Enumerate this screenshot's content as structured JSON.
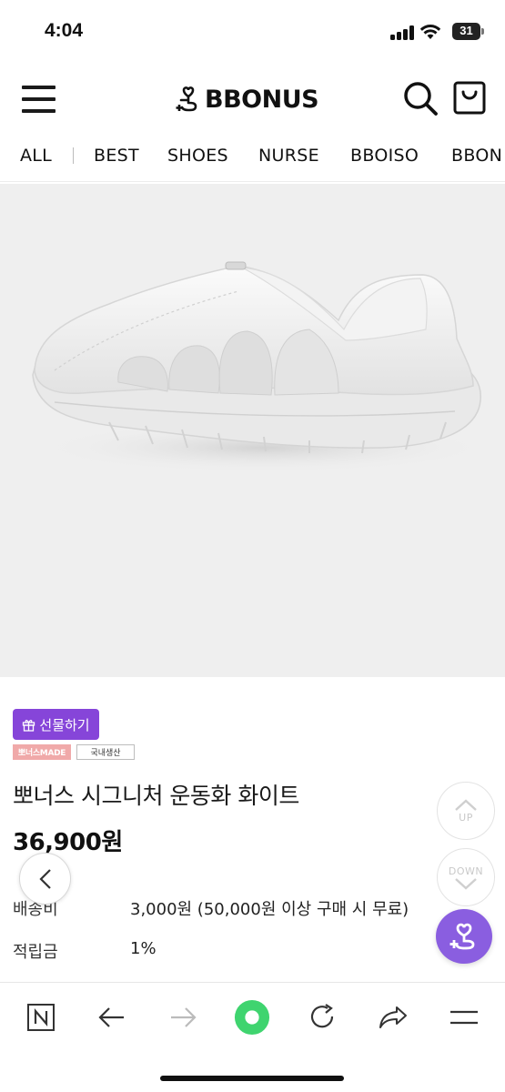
{
  "status_bar": {
    "time": "4:04",
    "battery": "31"
  },
  "header": {
    "logo_text": "BBONUS"
  },
  "categories": [
    "ALL",
    "BEST",
    "SHOES",
    "NURSE",
    "BBOISO",
    "BBON"
  ],
  "product": {
    "gift_label": "선물하기",
    "badge_made": "뽀너스MADE",
    "badge_domestic": "국내생산",
    "title": "뽀너스 시그니처 운동화 화이트",
    "price": "36,900원"
  },
  "info_rows": [
    {
      "label": "배송비",
      "value": "3,000원 (50,000원 이상 구매 시 무료)"
    },
    {
      "label": "적립금",
      "value": "1%"
    }
  ],
  "floating": {
    "up_label": "UP",
    "down_label": "DOWN"
  },
  "browser_bar": {
    "icons": [
      "naver-icon",
      "back-arrow-icon",
      "forward-arrow-icon",
      "green-dot-icon",
      "reload-icon",
      "share-icon",
      "menu-lines-icon"
    ]
  },
  "colors": {
    "accent_purple": "#8645d9",
    "browser_green": "#3fd46f",
    "badge_pink": "#f0a9a9"
  }
}
